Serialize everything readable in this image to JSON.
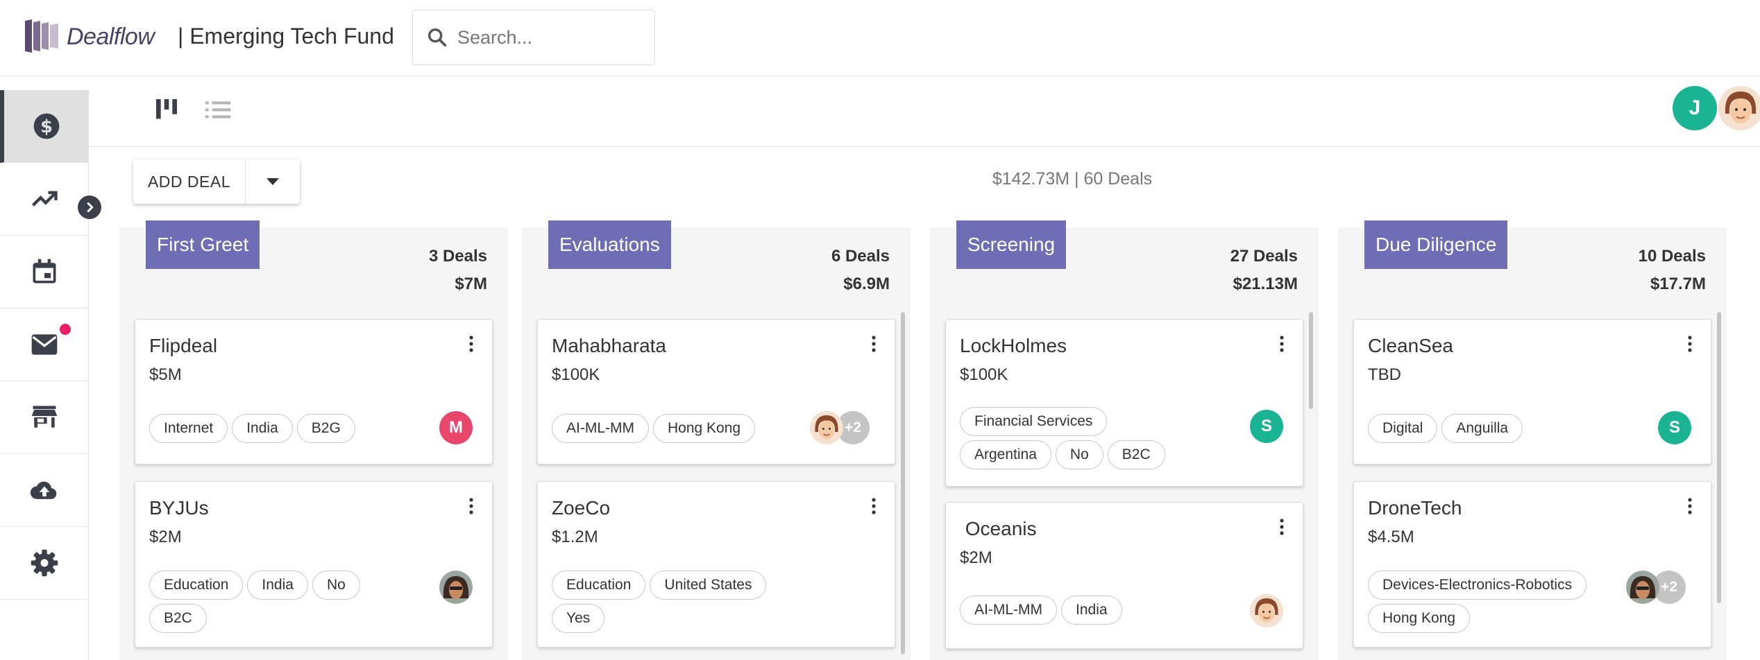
{
  "header": {
    "brand": "Dealflow",
    "fund_name": "| Emerging Tech Fund",
    "search_placeholder": "Search..."
  },
  "sidebar": {
    "items": [
      {
        "name": "deals",
        "icon": "dollar-circle-icon",
        "active": true
      },
      {
        "name": "analytics",
        "icon": "trending-up-icon"
      },
      {
        "name": "calendar",
        "icon": "calendar-icon"
      },
      {
        "name": "mail",
        "icon": "mail-icon",
        "has_notification": true
      },
      {
        "name": "store",
        "icon": "store-icon"
      },
      {
        "name": "upload",
        "icon": "cloud-upload-icon"
      },
      {
        "name": "settings",
        "icon": "gear-icon"
      }
    ]
  },
  "users": {
    "current_initial": "J"
  },
  "toolbar": {
    "add_deal_label": "ADD DEAL",
    "summary": "$142.73M | 60 Deals"
  },
  "columns": [
    {
      "title": "First Greet",
      "count": "3 Deals",
      "value": "$7M",
      "cards": [
        {
          "name": "Flipdeal",
          "amount": "$5M",
          "tags": [
            "Internet",
            "India",
            "B2G"
          ],
          "owner": "M",
          "owner_color": "#e8476b"
        },
        {
          "name": "BYJUs",
          "amount": "$2M",
          "tags": [
            "Education",
            "India",
            "No",
            "B2C"
          ],
          "owner": ""
        }
      ]
    },
    {
      "title": "Evaluations",
      "count": "6 Deals",
      "value": "$6.9M",
      "cards": [
        {
          "name": "Mahabharata",
          "amount": "$100K",
          "tags": [
            "AI-ML-MM",
            "Hong Kong"
          ],
          "owner_more": "+2"
        },
        {
          "name": "ZoeCo",
          "amount": "$1.2M",
          "tags": [
            "Education",
            "United States",
            "Yes"
          ]
        }
      ]
    },
    {
      "title": "Screening",
      "count": "27 Deals",
      "value": "$21.13M",
      "cards": [
        {
          "name": "LockHolmes",
          "amount": "$100K",
          "tags": [
            "Financial Services",
            "Argentina",
            "No",
            "B2C"
          ],
          "owner": "S",
          "owner_color": "#1ab394"
        },
        {
          "name": " Oceanis",
          "amount": "$2M",
          "tags": [
            "AI-ML-MM",
            "India"
          ]
        }
      ]
    },
    {
      "title": "Due Diligence",
      "count": "10 Deals",
      "value": "$17.7M",
      "cards": [
        {
          "name": "CleanSea",
          "amount": "TBD",
          "tags": [
            "Digital",
            "Anguilla"
          ],
          "owner": "S",
          "owner_color": "#1ab394"
        },
        {
          "name": "DroneTech",
          "amount": "$4.5M",
          "tags": [
            "Devices-Electronics-Robotics",
            "Hong Kong"
          ],
          "owner_more": "+2"
        }
      ]
    }
  ]
}
